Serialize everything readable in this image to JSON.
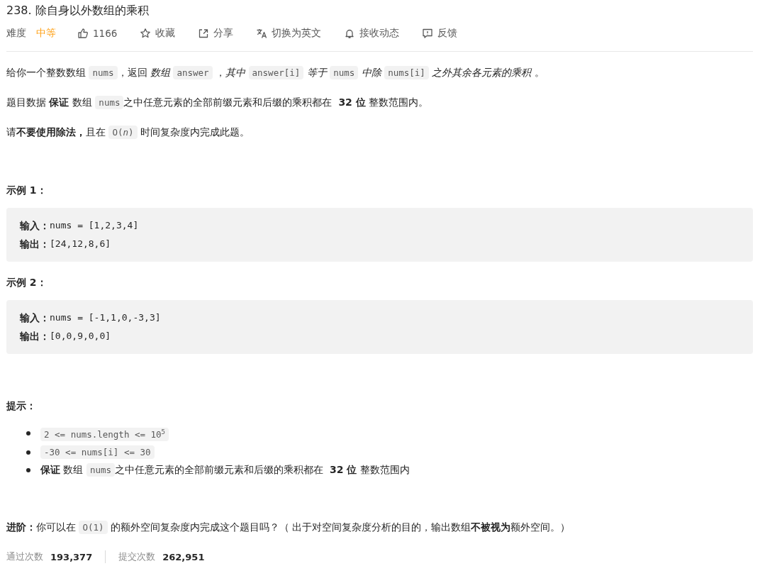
{
  "title": "238. 除自身以外数组的乘积",
  "meta": {
    "difficulty_label": "难度",
    "difficulty": "中等",
    "actions": [
      {
        "kind": "like",
        "label": "1166"
      },
      {
        "kind": "star",
        "label": "收藏"
      },
      {
        "kind": "share",
        "label": "分享"
      },
      {
        "kind": "translate",
        "label": "切换为英文"
      },
      {
        "kind": "bell",
        "label": "接收动态"
      },
      {
        "kind": "feedback",
        "label": "反馈"
      }
    ]
  },
  "description": [
    [
      {
        "kind": "text",
        "text": "给你一个整数数组 "
      },
      {
        "kind": "code",
        "text": "nums"
      },
      {
        "kind": "text",
        "text": "，返回 *数组* "
      },
      {
        "kind": "code",
        "text": "answer"
      },
      {
        "kind": "text",
        "text": " ，*其中* "
      },
      {
        "kind": "code",
        "text": "answer[i]"
      },
      {
        "kind": "text",
        "text": " *等于* "
      },
      {
        "kind": "code",
        "text": "nums"
      },
      {
        "kind": "text",
        "text": " *中除* "
      },
      {
        "kind": "code",
        "text": "nums[i]"
      },
      {
        "kind": "text",
        "text": " *之外其余各元素的乘积* 。"
      }
    ],
    [
      {
        "kind": "text",
        "text": "题目数据 **保证** 数组 "
      },
      {
        "kind": "code",
        "text": "nums"
      },
      {
        "kind": "text",
        "text": "之中任意元素的全部前缀元素和后缀的乘积都在  **32 位** 整数范围内。"
      }
    ],
    [
      {
        "kind": "text",
        "text": "请**不要使用除法，**且在 "
      },
      {
        "kind": "code",
        "text": "O(*n*)"
      },
      {
        "kind": "text",
        "text": " 时间复杂度内完成此题。"
      }
    ]
  ],
  "examples": [
    {
      "heading": "示例 1：",
      "lines": [
        {
          "label": "输入：",
          "value": "nums = [1,2,3,4]"
        },
        {
          "label": "输出：",
          "value": "[24,12,8,6]"
        }
      ]
    },
    {
      "heading": "示例 2：",
      "lines": [
        {
          "label": "输入：",
          "value": "nums = [-1,1,0,-3,3]"
        },
        {
          "label": "输出：",
          "value": "[0,0,9,0,0]"
        }
      ]
    }
  ],
  "hints": {
    "heading": "提示：",
    "items": [
      [
        {
          "kind": "code",
          "text": "2 <= nums.length <= 10$^{5}$"
        }
      ],
      [
        {
          "kind": "code",
          "text": "-30 <= nums[i] <= 30"
        }
      ],
      [
        {
          "kind": "text",
          "text": "**保证** 数组 "
        },
        {
          "kind": "code",
          "text": "nums"
        },
        {
          "kind": "text",
          "text": "之中任意元素的全部前缀元素和后缀的乘积都在  **32 位** 整数范围内"
        }
      ]
    ]
  },
  "follow_up": [
    {
      "kind": "text",
      "text": "**进阶：**你可以在 "
    },
    {
      "kind": "code",
      "text": "O(1)"
    },
    {
      "kind": "text",
      "text": " 的额外空间复杂度内完成这个题目吗？（ 出于对空间复杂度分析的目的，输出数组**不被视为**额外空间。）"
    }
  ],
  "stats": [
    {
      "label": "通过次数",
      "value": "193,377"
    },
    {
      "label": "提交次数",
      "value": "262,951"
    }
  ]
}
